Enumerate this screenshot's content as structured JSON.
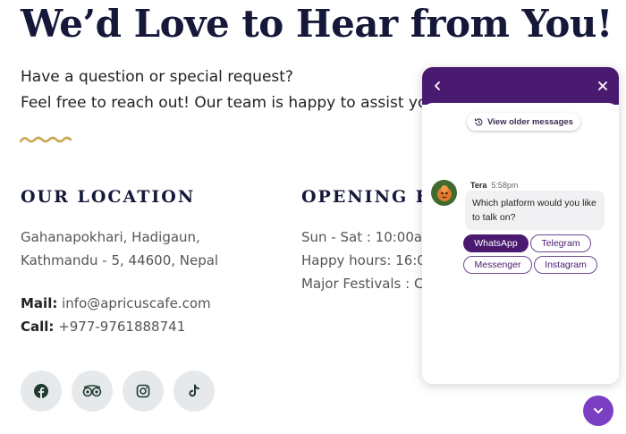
{
  "hero": {
    "title": "We’d Love to Hear from You!",
    "intro_line1": "Have a question or special request?",
    "intro_line2": "Feel free to reach out! Our team is happy to assist you"
  },
  "location": {
    "title": "OUR LOCATION",
    "address_line1": "Gahanapokhari, Hadigaun,",
    "address_line2": "Kathmandu - 5, 44600, Nepal",
    "mail_label": "Mail:",
    "mail_value": " info@apricuscafe.com",
    "call_label": "Call:",
    "call_value": " +977-9761888741"
  },
  "hours": {
    "title": "OPENING HO",
    "line1": "Sun - Sat : 10:00an",
    "line2": "Happy hours: 16:00",
    "line3": "Major Festivals : Cl"
  },
  "socials": [
    {
      "icon": "facebook-icon"
    },
    {
      "icon": "tripadvisor-icon"
    },
    {
      "icon": "instagram-icon"
    },
    {
      "icon": "tiktok-icon"
    }
  ],
  "chat": {
    "older_label": "View older messages",
    "sender": "Tera",
    "time": "5:58pm",
    "message": "Which platform would you like to talk on?",
    "options": [
      "WhatsApp",
      "Telegram",
      "Messenger",
      "Instagram"
    ],
    "selected_option": "WhatsApp"
  },
  "colors": {
    "navy": "#16183a",
    "accent_gold": "#c9a44c",
    "chat_purple": "#4a1a70",
    "fab_purple": "#7b3fc4"
  }
}
